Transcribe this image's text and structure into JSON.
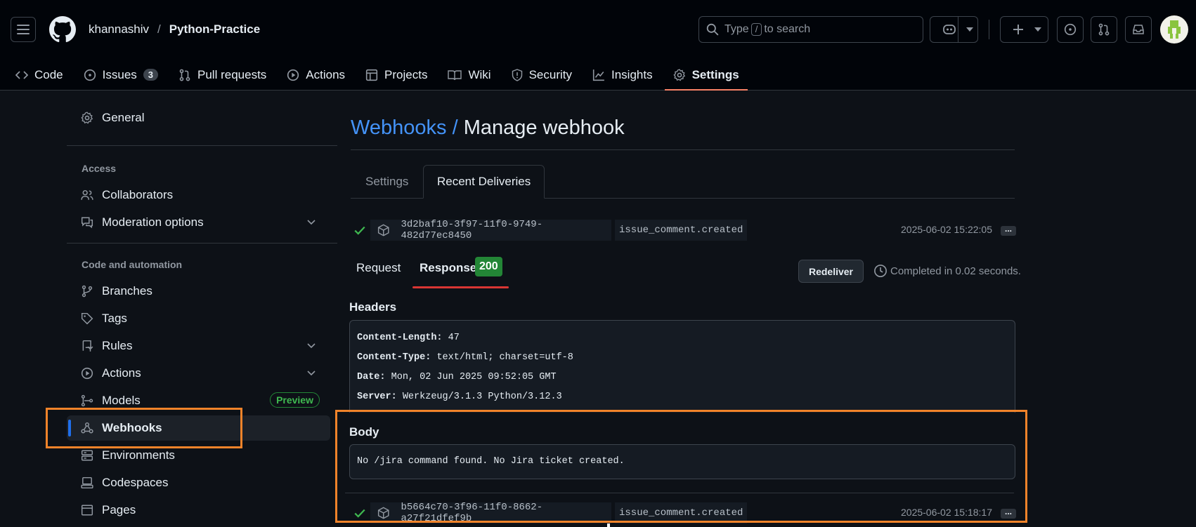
{
  "header": {
    "owner": "khannashiv",
    "separator": "/",
    "repo": "Python-Practice",
    "search": {
      "prefix": "Type",
      "key": "/",
      "suffix": "to search"
    }
  },
  "repo_nav": {
    "items": [
      {
        "label": "Code",
        "icon": "code-icon"
      },
      {
        "label": "Issues",
        "icon": "issue-icon",
        "count": "3"
      },
      {
        "label": "Pull requests",
        "icon": "pull-request-icon"
      },
      {
        "label": "Actions",
        "icon": "play-icon"
      },
      {
        "label": "Projects",
        "icon": "table-icon"
      },
      {
        "label": "Wiki",
        "icon": "book-icon"
      },
      {
        "label": "Security",
        "icon": "shield-icon"
      },
      {
        "label": "Insights",
        "icon": "graph-icon"
      },
      {
        "label": "Settings",
        "icon": "gear-icon",
        "active": true
      }
    ]
  },
  "sidebar": {
    "general": "General",
    "access_heading": "Access",
    "collaborators": "Collaborators",
    "moderation": "Moderation options",
    "code_heading": "Code and automation",
    "branches": "Branches",
    "tags": "Tags",
    "rules": "Rules",
    "actions": "Actions",
    "models": "Models",
    "models_badge": "Preview",
    "webhooks": "Webhooks",
    "environments": "Environments",
    "codespaces": "Codespaces",
    "pages": "Pages"
  },
  "page": {
    "breadcrumb_link": "Webhooks",
    "breadcrumb_sep": "/",
    "title": "Manage webhook",
    "tabs": {
      "settings": "Settings",
      "recent": "Recent Deliveries"
    }
  },
  "deliveries": [
    {
      "guid": "3d2baf10-3f97-11f0-9749-482d77ec8450",
      "event": "issue_comment.created",
      "timestamp": "2025-06-02 15:22:05",
      "more": "..."
    },
    {
      "guid": "b5664c70-3f96-11f0-8662-a27f21dfef9b",
      "event": "issue_comment.created",
      "timestamp": "2025-06-02 15:18:17",
      "more": "..."
    }
  ],
  "detail": {
    "request_tab": "Request",
    "response_tab": "Response",
    "status_code": "200",
    "redeliver": "Redeliver",
    "completed": "Completed in 0.02 seconds.",
    "headers_title": "Headers",
    "headers": [
      {
        "key": "Content-Length:",
        "value": "47"
      },
      {
        "key": "Content-Type:",
        "value": "text/html; charset=utf-8"
      },
      {
        "key": "Date:",
        "value": "Mon, 02 Jun 2025 09:52:05 GMT"
      },
      {
        "key": "Server:",
        "value": "Werkzeug/3.1.3 Python/3.12.3"
      }
    ],
    "body_title": "Body",
    "body": "No /jira command found. No Jira ticket created."
  },
  "colors": {
    "accent_link": "#4493f8",
    "success": "#238636",
    "highlight_box": "#f0832a",
    "active_underline": "#f78166"
  }
}
